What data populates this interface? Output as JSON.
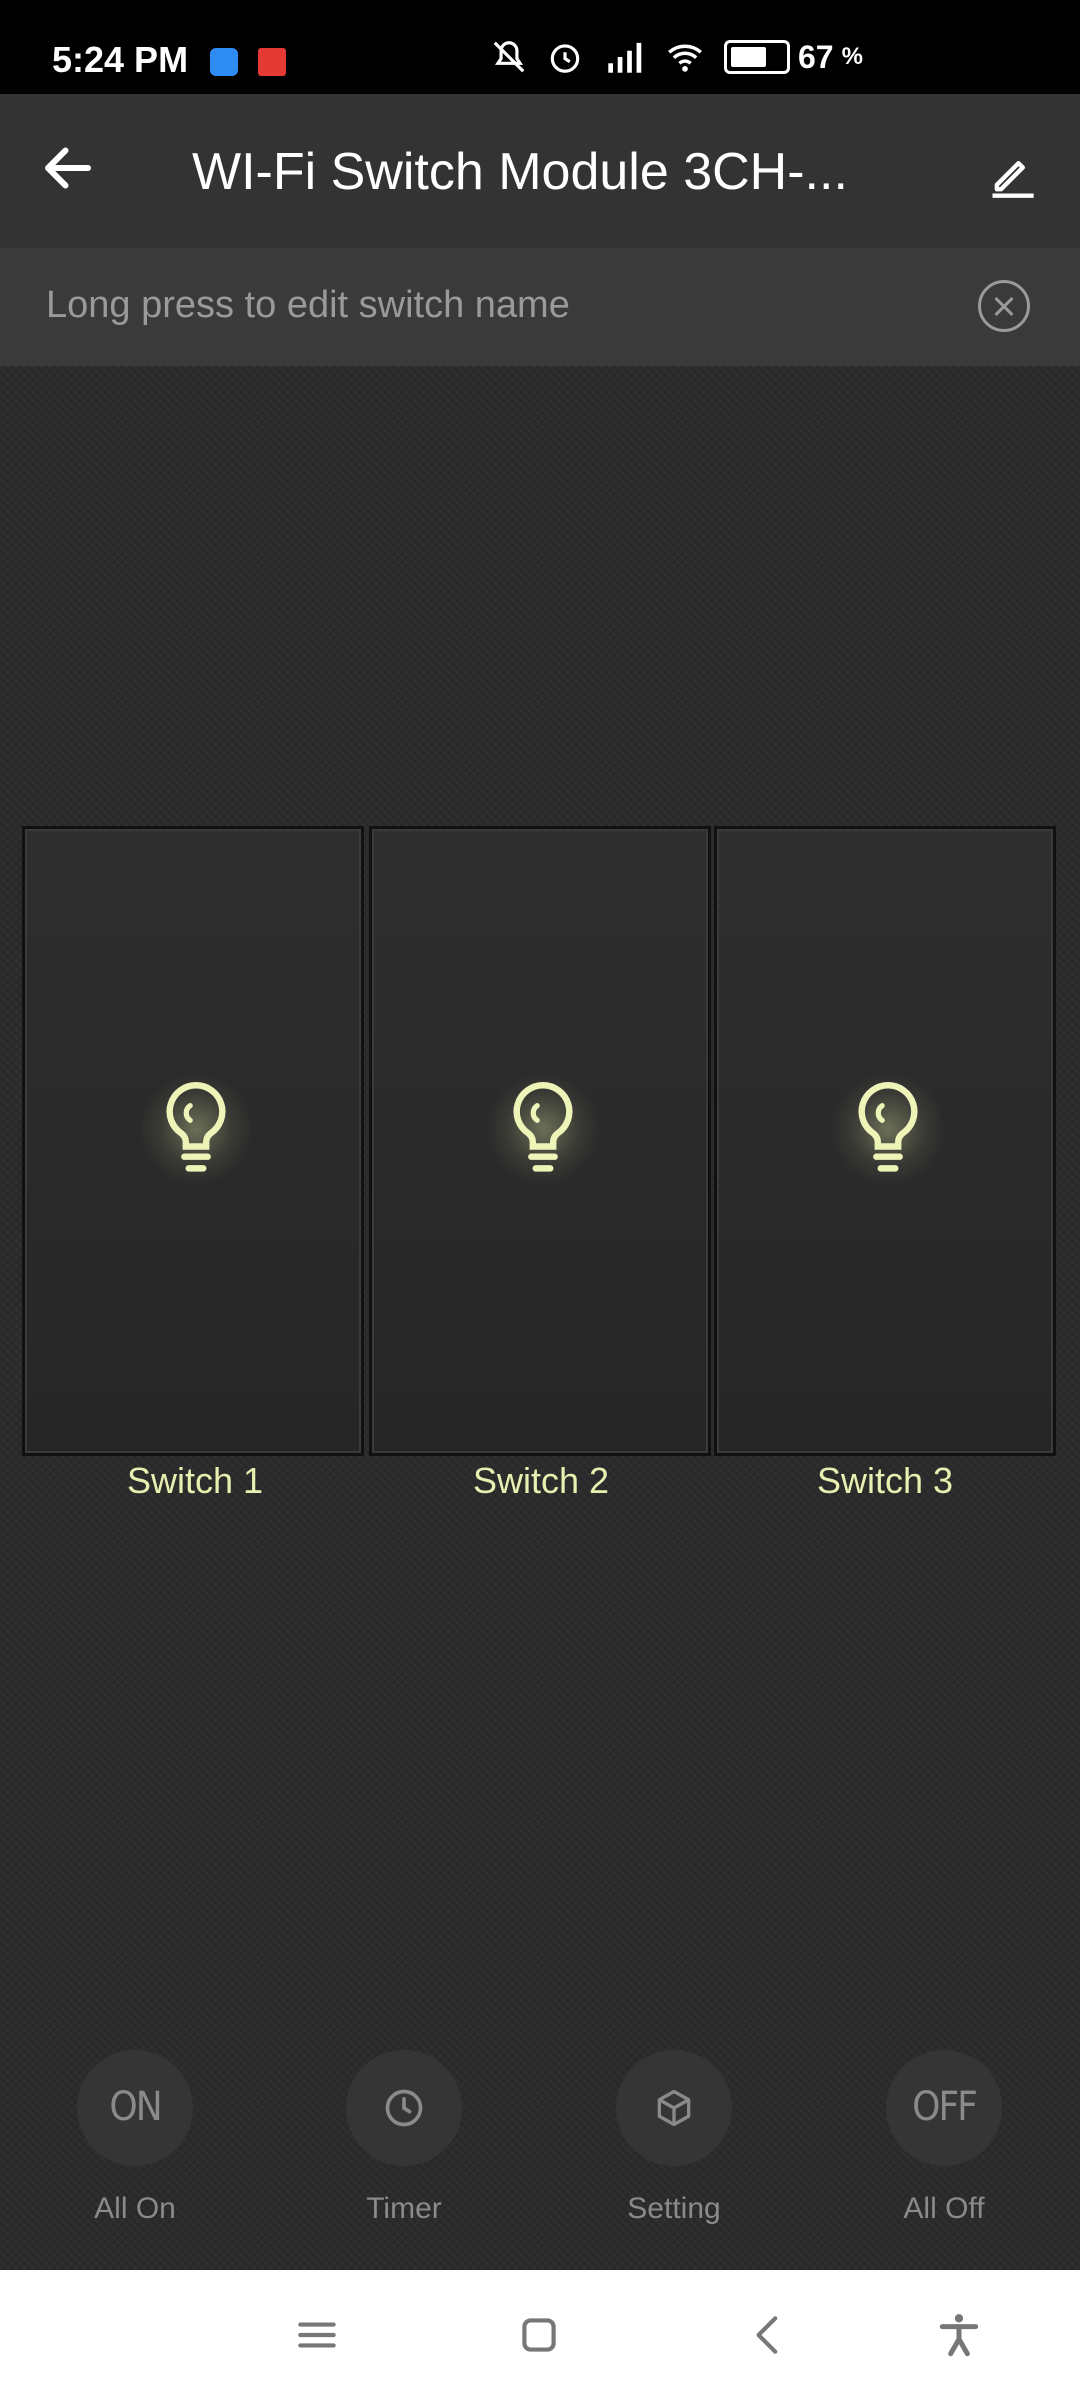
{
  "status_bar": {
    "time": "5:24 PM",
    "battery_percent": "67",
    "battery_suffix": "%",
    "battery_level": 0.67,
    "icons": [
      "cloud-app-icon",
      "news-app-icon",
      "mute-icon",
      "alarm-icon",
      "hd-signal-icon",
      "wifi-icon",
      "battery-icon"
    ]
  },
  "app_bar": {
    "title": "WI-Fi Switch Module 3CH-...",
    "back_icon": "back-arrow-icon",
    "edit_icon": "pencil-icon"
  },
  "hint": {
    "text": "Long press to edit switch name",
    "close_icon": "close-circle-icon"
  },
  "switches": [
    {
      "label": "Switch 1",
      "icon": "bulb-icon"
    },
    {
      "label": "Switch 2",
      "icon": "bulb-icon"
    },
    {
      "label": "Switch 3",
      "icon": "bulb-icon"
    }
  ],
  "actions": [
    {
      "label": "All On",
      "icon_text": "ON"
    },
    {
      "label": "Timer",
      "icon": "clock-icon"
    },
    {
      "label": "Setting",
      "icon": "cube-icon"
    },
    {
      "label": "All Off",
      "icon_text": "OFF"
    }
  ],
  "nav_bar": {
    "icons": [
      "menu-icon",
      "home-icon",
      "back-icon",
      "accessibility-icon"
    ]
  },
  "colors": {
    "accent": "#e8efb0",
    "background": "#2b2b2b",
    "app_bar": "#333333",
    "hint_bar": "#3a3a3a"
  }
}
